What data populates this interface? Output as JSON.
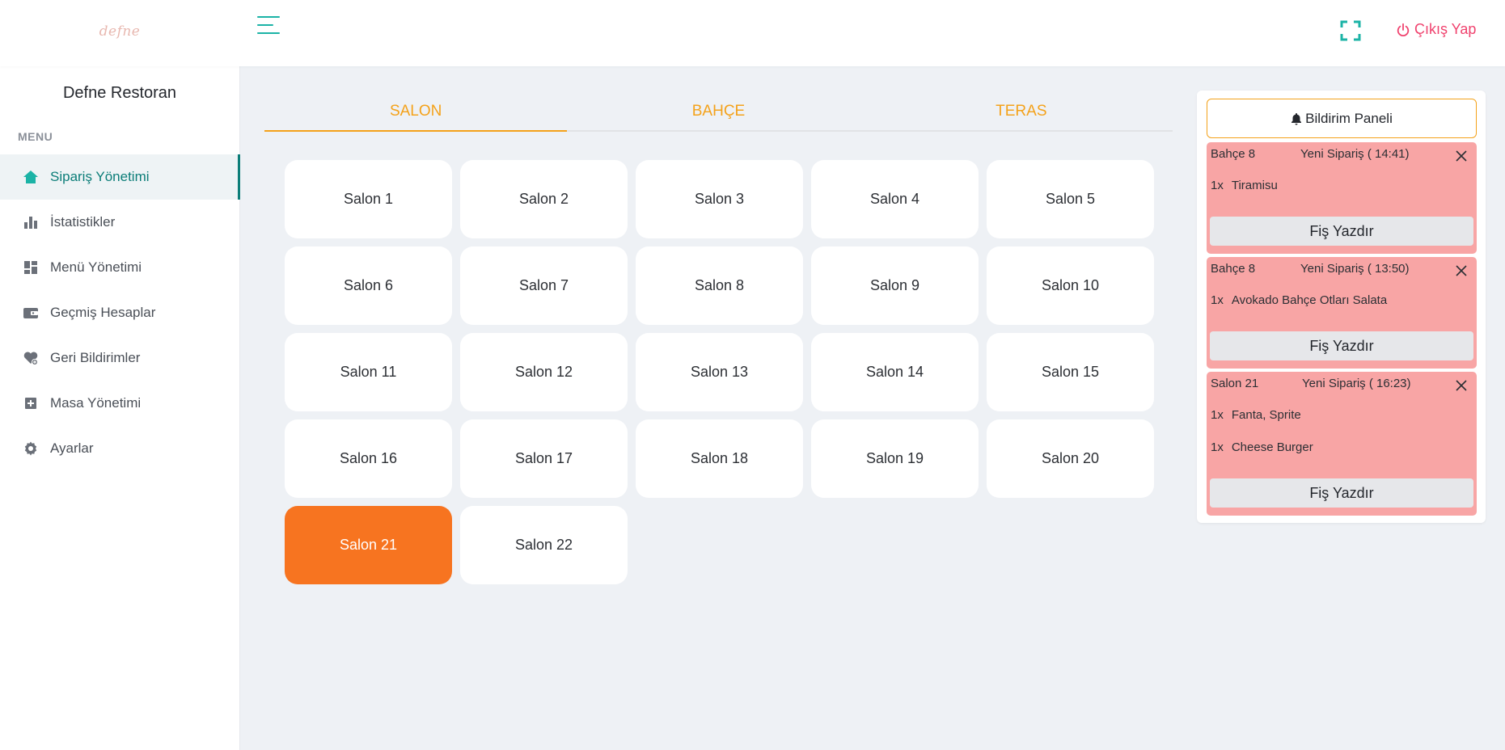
{
  "header": {
    "logo_text": "defne",
    "logout_label": "Çıkış Yap"
  },
  "sidebar": {
    "brand": "Defne Restoran",
    "menu_label": "MENU",
    "items": [
      {
        "label": "Sipariş Yönetimi",
        "icon": "home-icon"
      },
      {
        "label": "İstatistikler",
        "icon": "bar-chart-icon"
      },
      {
        "label": "Menü Yönetimi",
        "icon": "dashboard-icon"
      },
      {
        "label": "Geçmiş Hesaplar",
        "icon": "wallet-icon"
      },
      {
        "label": "Geri Bildirimler",
        "icon": "heart-icon"
      },
      {
        "label": "Masa Yönetimi",
        "icon": "plus-square-icon"
      },
      {
        "label": "Ayarlar",
        "icon": "gear-icon"
      }
    ]
  },
  "tabs": [
    {
      "label": "SALON"
    },
    {
      "label": "BAHÇE"
    },
    {
      "label": "TERAS"
    }
  ],
  "tables": [
    "Salon 1",
    "Salon 2",
    "Salon 3",
    "Salon 4",
    "Salon 5",
    "Salon 6",
    "Salon 7",
    "Salon 8",
    "Salon 9",
    "Salon 10",
    "Salon 11",
    "Salon 12",
    "Salon 13",
    "Salon 14",
    "Salon 15",
    "Salon 16",
    "Salon 17",
    "Salon 18",
    "Salon 19",
    "Salon 20",
    "Salon 21",
    "Salon 22"
  ],
  "occupied_table": "Salon 21",
  "colors": {
    "accent_teal": "#0b7d78",
    "tab_orange": "#f4a21a",
    "occupied_orange": "#f77420",
    "notification_red": "#f8a5a5",
    "logout_pink": "#f0426e"
  },
  "notifications": {
    "title": "Bildirim Paneli",
    "cards": [
      {
        "table": "Bahçe 8",
        "status": "Yeni Sipariş ( 14:41)",
        "items": [
          {
            "qty": "1x",
            "name": "Tiramisu"
          }
        ],
        "print_label": "Fiş Yazdır"
      },
      {
        "table": "Bahçe 8",
        "status": "Yeni Sipariş ( 13:50)",
        "items": [
          {
            "qty": "1x",
            "name": "Avokado Bahçe Otları Salata"
          }
        ],
        "print_label": "Fiş Yazdır"
      },
      {
        "table": "Salon 21",
        "status": "Yeni Sipariş ( 16:23)",
        "items": [
          {
            "qty": "1x",
            "name": "Fanta, Sprite"
          },
          {
            "qty": "1x",
            "name": "Cheese Burger"
          }
        ],
        "print_label": "Fiş Yazdır"
      }
    ]
  }
}
